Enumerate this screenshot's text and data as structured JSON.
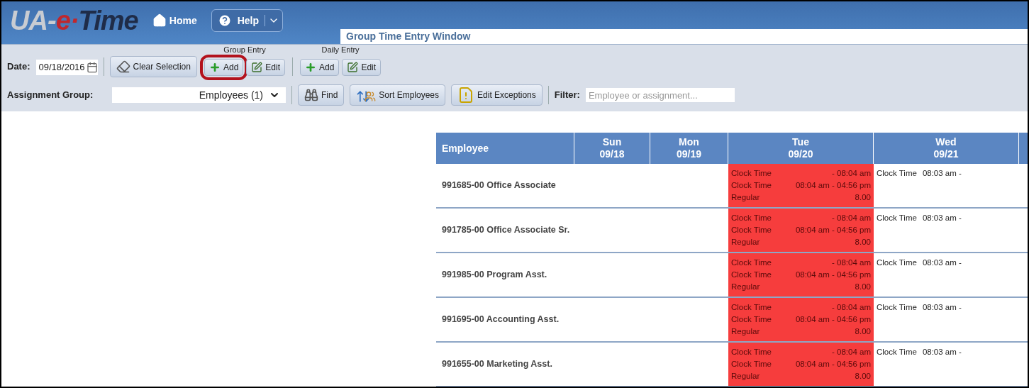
{
  "logo": [
    {
      "text": "UA-",
      "color": "#c9ccd2"
    },
    {
      "text": "e·",
      "color": "#c0272d"
    },
    {
      "text": "Time",
      "color": "#1f2c48"
    }
  ],
  "nav": {
    "home": "Home",
    "help": "Help"
  },
  "window_title": "Group Time Entry Window",
  "toolbar": {
    "date_label": "Date:",
    "date_value": "09/18/2016",
    "clear": "Clear Selection",
    "groups": [
      {
        "label": "Group Entry",
        "buttons": [
          {
            "kind": "add",
            "label": "Add",
            "highlighted": true
          },
          {
            "kind": "edit",
            "label": "Edit",
            "highlighted": false
          }
        ]
      },
      {
        "label": "Daily Entry",
        "buttons": [
          {
            "kind": "add",
            "label": "Add",
            "highlighted": false
          },
          {
            "kind": "edit",
            "label": "Edit",
            "highlighted": false
          }
        ]
      }
    ],
    "assignment_label": "Assignment Group:",
    "assignment_value": "Employees (1)",
    "actions": [
      {
        "kind": "find",
        "label": "Find"
      },
      {
        "kind": "sort",
        "label": "Sort Employees"
      },
      {
        "kind": "exceptions",
        "label": "Edit Exceptions"
      }
    ],
    "filter_label": "Filter:",
    "filter_placeholder": "Employee or assignment..."
  },
  "table": {
    "employee_header": "Employee",
    "days": [
      {
        "day": "Sun",
        "date": "09/18"
      },
      {
        "day": "Mon",
        "date": "09/19"
      },
      {
        "day": "Tue",
        "date": "09/20"
      },
      {
        "day": "Wed",
        "date": "09/21"
      }
    ],
    "rows": [
      {
        "employee": "991685-00 Office Associate",
        "cells": [
          {
            "flagged": false
          },
          {
            "flagged": false
          },
          {
            "flagged": true,
            "entries": [
              {
                "label": "Clock Time",
                "value": "- 08:04 am"
              },
              {
                "label": "Clock Time",
                "value": "08:04 am - 04:56 pm"
              },
              {
                "label": "Regular",
                "value": "8.00"
              }
            ]
          },
          {
            "flagged": false,
            "entries": [
              {
                "label": "Clock Time",
                "value": "08:03 am -"
              }
            ]
          }
        ]
      },
      {
        "employee": "991785-00 Office Associate Sr.",
        "cells": [
          {
            "flagged": false
          },
          {
            "flagged": false
          },
          {
            "flagged": true,
            "entries": [
              {
                "label": "Clock Time",
                "value": "- 08:04 am"
              },
              {
                "label": "Clock Time",
                "value": "08:04 am - 04:56 pm"
              },
              {
                "label": "Regular",
                "value": "8.00"
              }
            ]
          },
          {
            "flagged": false,
            "entries": [
              {
                "label": "Clock Time",
                "value": "08:03 am -"
              }
            ]
          }
        ]
      },
      {
        "employee": "991985-00 Program Asst.",
        "cells": [
          {
            "flagged": false
          },
          {
            "flagged": false
          },
          {
            "flagged": true,
            "entries": [
              {
                "label": "Clock Time",
                "value": "- 08:04 am"
              },
              {
                "label": "Clock Time",
                "value": "08:04 am - 04:56 pm"
              },
              {
                "label": "Regular",
                "value": "8.00"
              }
            ]
          },
          {
            "flagged": false,
            "entries": [
              {
                "label": "Clock Time",
                "value": "08:03 am -"
              }
            ]
          }
        ]
      },
      {
        "employee": "991695-00 Accounting Asst.",
        "cells": [
          {
            "flagged": false
          },
          {
            "flagged": false
          },
          {
            "flagged": true,
            "entries": [
              {
                "label": "Clock Time",
                "value": "- 08:04 am"
              },
              {
                "label": "Clock Time",
                "value": "08:04 am - 04:56 pm"
              },
              {
                "label": "Regular",
                "value": "8.00"
              }
            ]
          },
          {
            "flagged": false,
            "entries": [
              {
                "label": "Clock Time",
                "value": "08:03 am -"
              }
            ]
          }
        ]
      },
      {
        "employee": "991655-00 Marketing Asst.",
        "cells": [
          {
            "flagged": false
          },
          {
            "flagged": false
          },
          {
            "flagged": true,
            "entries": [
              {
                "label": "Clock Time",
                "value": "- 08:04 am"
              },
              {
                "label": "Clock Time",
                "value": "08:04 am - 04:56 pm"
              },
              {
                "label": "Regular",
                "value": "8.00"
              }
            ]
          },
          {
            "flagged": false,
            "entries": [
              {
                "label": "Clock Time",
                "value": "08:03 am -"
              }
            ]
          }
        ]
      }
    ]
  }
}
